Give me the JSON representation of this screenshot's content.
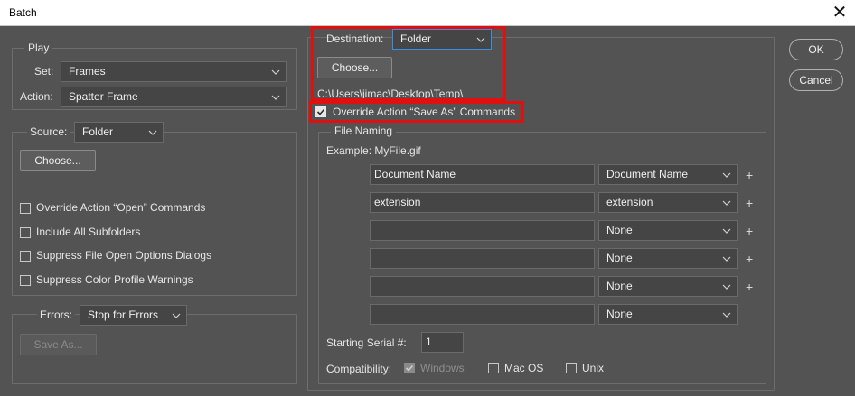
{
  "window": {
    "title": "Batch"
  },
  "dialog_buttons": {
    "ok": "OK",
    "cancel": "Cancel"
  },
  "play": {
    "legend": "Play",
    "set_label": "Set:",
    "set_value": "Frames",
    "action_label": "Action:",
    "action_value": "Spatter Frame"
  },
  "source": {
    "label": "Source:",
    "value": "Folder",
    "choose": "Choose...",
    "options": [
      "Override Action “Open” Commands",
      "Include All Subfolders",
      "Suppress File Open Options Dialogs",
      "Suppress Color Profile Warnings"
    ]
  },
  "errors": {
    "label": "Errors:",
    "value": "Stop for Errors",
    "save_as": "Save As..."
  },
  "destination": {
    "label": "Destination:",
    "value": "Folder",
    "choose": "Choose...",
    "path": "C:\\Users\\jimac\\Desktop\\Temp\\",
    "override_label": "Override Action “Save As” Commands"
  },
  "file_naming": {
    "legend": "File Naming",
    "example": "Example: MyFile.gif",
    "rows": [
      {
        "text": "Document Name",
        "select": "Document Name",
        "plus": "+"
      },
      {
        "text": "extension",
        "select": "extension",
        "plus": "+"
      },
      {
        "text": "",
        "select": "None",
        "plus": "+"
      },
      {
        "text": "",
        "select": "None",
        "plus": "+"
      },
      {
        "text": "",
        "select": "None",
        "plus": "+"
      },
      {
        "text": "",
        "select": "None",
        "plus": ""
      }
    ],
    "serial_label": "Starting Serial #:",
    "serial_value": "1",
    "compat_label": "Compatibility:",
    "compat": [
      "Windows",
      "Mac OS",
      "Unix"
    ]
  },
  "colors": {
    "highlight": "#e01010",
    "focus": "#3b8ee6",
    "background": "#535353"
  },
  "icons": {
    "close": "close-icon",
    "dropdown": "chevron-down-icon",
    "check": "check-icon"
  }
}
